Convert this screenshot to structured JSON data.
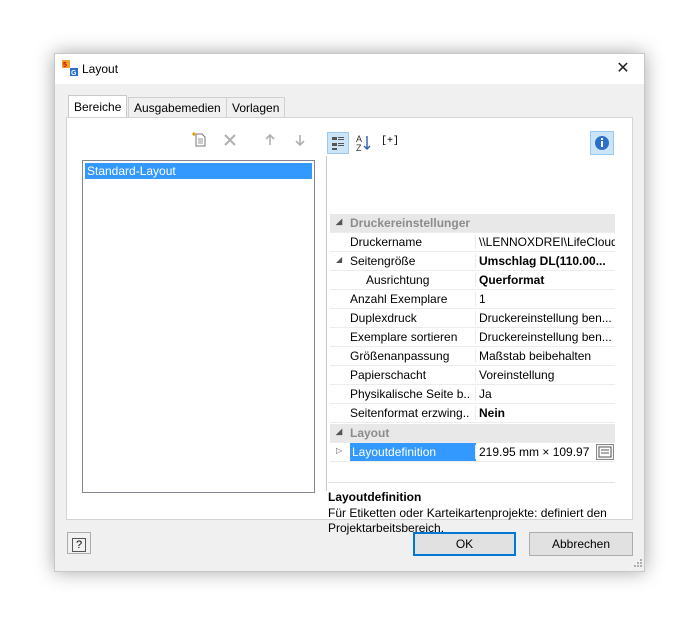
{
  "window": {
    "title": "Layout",
    "close_symbol": "✕",
    "icon_text": "5G"
  },
  "tabs": [
    {
      "label": "Bereiche"
    },
    {
      "label": "Ausgabemedien"
    },
    {
      "label": "Vorlagen"
    }
  ],
  "left_list": {
    "items": [
      {
        "label": "Standard-Layout"
      }
    ]
  },
  "left_toolbar": {
    "icons": [
      "new-icon",
      "delete-icon",
      "up-arrow-icon",
      "down-arrow-icon"
    ]
  },
  "prop_toolbar": {
    "icons": [
      "categorized-icon",
      "sort-alpha-icon",
      "expand-collapse-icon",
      "info-icon"
    ],
    "expand_text": "[+]",
    "sort_text": "A↓Z"
  },
  "properties": {
    "cat1": "Druckereinstellungen",
    "rows1": [
      {
        "name": "Druckername",
        "value": "\\\\LENNOXDREI\\LifeCloud"
      },
      {
        "name": "Seitengröße",
        "value": "Umschlag DL(110.00..."
      },
      {
        "name": "Ausrichtung",
        "value": "Querformat"
      },
      {
        "name": "Anzahl Exemplare",
        "value": "1"
      },
      {
        "name": "Duplexdruck",
        "value": "Druckereinstellung ben..."
      },
      {
        "name": "Exemplare sortieren",
        "value": "Druckereinstellung ben..."
      },
      {
        "name": "Größenanpassung",
        "value": "Maßstab beibehalten"
      },
      {
        "name": "Papierschacht",
        "value": "Voreinstellung"
      },
      {
        "name": "Physikalische Seite b...",
        "value": "Ja"
      },
      {
        "name": "Seitenformat erzwing...",
        "value": "Nein"
      }
    ],
    "cat2": "Layout",
    "rows2": [
      {
        "name": "Layoutdefinition",
        "value": "219.95 mm × 109.97 ..."
      }
    ]
  },
  "description": {
    "title": "Layoutdefinition",
    "text": "Für Etiketten oder Karteikartenprojekte: definiert den Projektarbeitsbereich."
  },
  "buttons": {
    "ok": "OK",
    "cancel": "Abbrechen",
    "help_symbol": "?"
  },
  "colors": {
    "selection": "#3399ff",
    "accent": "#0078d7"
  }
}
